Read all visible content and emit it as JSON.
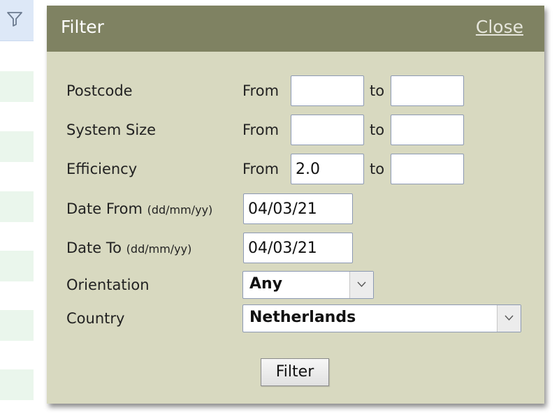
{
  "background": {
    "funnel_icon": "filter-funnel-icon",
    "row_color": "#eaf6ec"
  },
  "dialog": {
    "title": "Filter",
    "close_label": "Close",
    "header_color": "#7f8262",
    "body_color": "#d8d9c0"
  },
  "fields": {
    "from_label": "From",
    "to_label": "to",
    "postcode": {
      "label": "Postcode",
      "from_value": "",
      "to_value": ""
    },
    "system_size": {
      "label": "System Size",
      "from_value": "",
      "to_value": ""
    },
    "efficiency": {
      "label": "Efficiency",
      "from_value": "2.0",
      "to_value": ""
    },
    "date_from": {
      "label": "Date From",
      "hint": "(dd/mm/yy)",
      "value": "04/03/21"
    },
    "date_to": {
      "label": "Date To",
      "hint": "(dd/mm/yy)",
      "value": "04/03/21"
    },
    "orientation": {
      "label": "Orientation",
      "selected": "Any"
    },
    "country": {
      "label": "Country",
      "selected": "Netherlands"
    }
  },
  "actions": {
    "filter_label": "Filter"
  }
}
